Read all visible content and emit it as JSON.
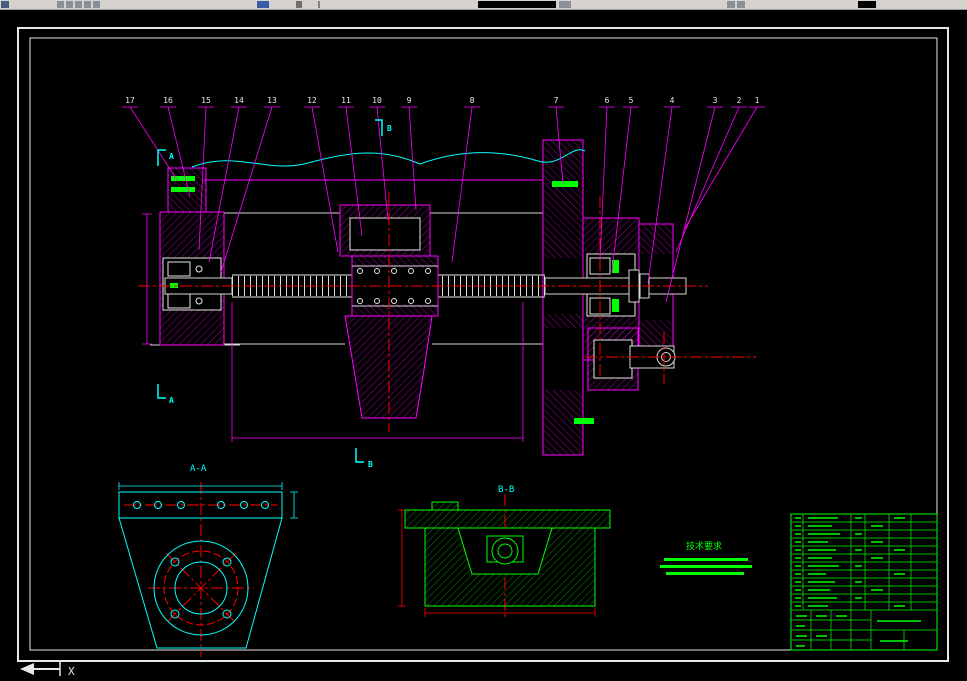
{
  "callouts": [
    "17",
    "16",
    "15",
    "14",
    "13",
    "12",
    "11",
    "10",
    "9",
    "8",
    "7",
    "6",
    "5",
    "4",
    "3",
    "2",
    "1"
  ],
  "section_views": {
    "aa_label": "A-A",
    "bb_label": "B-B"
  },
  "cutting_marks": {
    "a": "A",
    "b": "B"
  },
  "tech_requirements": {
    "title": "技术要求"
  },
  "ucs": {
    "x_axis_label": "X"
  },
  "colors": {
    "background": "#000000",
    "sheet_frame": "#E8E8E8",
    "part_lines_magenta": "#FF00FF",
    "aux_lines_cyan": "#00FFFF",
    "centerlines_red": "#FF0000",
    "table_green": "#00FF00",
    "toolbar_bg": "#D6D3CE"
  }
}
